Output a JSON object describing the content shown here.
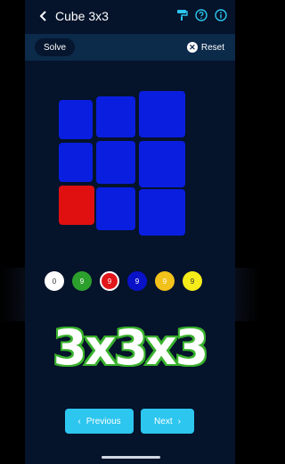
{
  "header": {
    "title": "Cube 3x3",
    "back_icon": "back-arrow-icon",
    "icons": [
      "paint-roller-icon",
      "help-icon",
      "info-icon"
    ]
  },
  "toolbar": {
    "solve_label": "Solve",
    "reset_label": "Reset",
    "reset_icon": "close-circle-icon"
  },
  "cube_face": {
    "rows": [
      [
        "blue",
        "blue",
        "blue"
      ],
      [
        "blue",
        "blue",
        "blue"
      ],
      [
        "red",
        "blue",
        "blue"
      ]
    ],
    "colors": {
      "blue": "#0a1ee0",
      "red": "#e01010"
    }
  },
  "palette": [
    {
      "color": "white",
      "hex": "#ffffff",
      "count": "0",
      "text_color": "#333333"
    },
    {
      "color": "green",
      "hex": "#2ca02c",
      "count": "9",
      "text_color": "#ffffff"
    },
    {
      "color": "red",
      "hex": "#e0161b",
      "count": "9",
      "text_color": "#ffffff",
      "selected": true
    },
    {
      "color": "blue",
      "hex": "#0a12c8",
      "count": "9",
      "text_color": "#ffffff"
    },
    {
      "color": "yellow",
      "hex": "#f2c21b",
      "count": "9",
      "text_color": "#ffffff"
    },
    {
      "color": "yellow",
      "hex": "#f5ec1a",
      "count": "9",
      "text_color": "#333333"
    }
  ],
  "brand_text": "3x3x3",
  "navigation": {
    "previous_label": "Previous",
    "next_label": "Next"
  }
}
